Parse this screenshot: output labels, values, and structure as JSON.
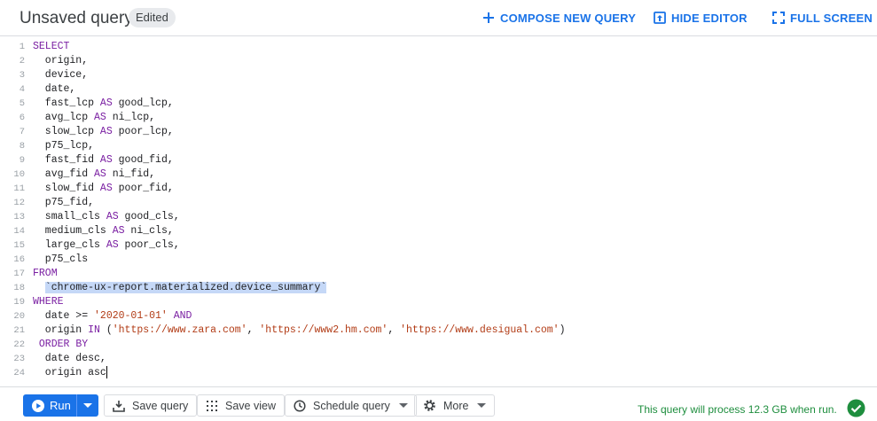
{
  "header": {
    "title": "Unsaved query",
    "badge": "Edited",
    "compose_label": "COMPOSE NEW QUERY",
    "hide_label": "HIDE EDITOR",
    "fullscreen_label": "FULL SCREEN"
  },
  "editor": {
    "lines": [
      {
        "n": "1",
        "segs": [
          {
            "t": "SELECT",
            "c": "kw"
          }
        ]
      },
      {
        "n": "2",
        "segs": [
          {
            "t": "  origin,",
            "c": ""
          }
        ]
      },
      {
        "n": "3",
        "segs": [
          {
            "t": "  device,",
            "c": ""
          }
        ]
      },
      {
        "n": "4",
        "segs": [
          {
            "t": "  date,",
            "c": ""
          }
        ]
      },
      {
        "n": "5",
        "segs": [
          {
            "t": "  fast_lcp ",
            "c": ""
          },
          {
            "t": "AS",
            "c": "kw"
          },
          {
            "t": " good_lcp,",
            "c": ""
          }
        ]
      },
      {
        "n": "6",
        "segs": [
          {
            "t": "  avg_lcp ",
            "c": ""
          },
          {
            "t": "AS",
            "c": "kw"
          },
          {
            "t": " ni_lcp,",
            "c": ""
          }
        ]
      },
      {
        "n": "7",
        "segs": [
          {
            "t": "  slow_lcp ",
            "c": ""
          },
          {
            "t": "AS",
            "c": "kw"
          },
          {
            "t": " poor_lcp,",
            "c": ""
          }
        ]
      },
      {
        "n": "8",
        "segs": [
          {
            "t": "  p75_lcp,",
            "c": ""
          }
        ]
      },
      {
        "n": "9",
        "segs": [
          {
            "t": "  fast_fid ",
            "c": ""
          },
          {
            "t": "AS",
            "c": "kw"
          },
          {
            "t": " good_fid,",
            "c": ""
          }
        ]
      },
      {
        "n": "10",
        "segs": [
          {
            "t": "  avg_fid ",
            "c": ""
          },
          {
            "t": "AS",
            "c": "kw"
          },
          {
            "t": " ni_fid,",
            "c": ""
          }
        ]
      },
      {
        "n": "11",
        "segs": [
          {
            "t": "  slow_fid ",
            "c": ""
          },
          {
            "t": "AS",
            "c": "kw"
          },
          {
            "t": " poor_fid,",
            "c": ""
          }
        ]
      },
      {
        "n": "12",
        "segs": [
          {
            "t": "  p75_fid,",
            "c": ""
          }
        ]
      },
      {
        "n": "13",
        "segs": [
          {
            "t": "  small_cls ",
            "c": ""
          },
          {
            "t": "AS",
            "c": "kw"
          },
          {
            "t": " good_cls,",
            "c": ""
          }
        ]
      },
      {
        "n": "14",
        "segs": [
          {
            "t": "  medium_cls ",
            "c": ""
          },
          {
            "t": "AS",
            "c": "kw"
          },
          {
            "t": " ni_cls,",
            "c": ""
          }
        ]
      },
      {
        "n": "15",
        "segs": [
          {
            "t": "  large_cls ",
            "c": ""
          },
          {
            "t": "AS",
            "c": "kw"
          },
          {
            "t": " poor_cls,",
            "c": ""
          }
        ]
      },
      {
        "n": "16",
        "segs": [
          {
            "t": "  p75_cls",
            "c": ""
          }
        ]
      },
      {
        "n": "17",
        "segs": [
          {
            "t": "FROM",
            "c": "kw"
          }
        ]
      },
      {
        "n": "18",
        "segs": [
          {
            "t": "  ",
            "c": ""
          },
          {
            "t": "`chrome-ux-report.materialized.device_summary`",
            "c": "hl"
          }
        ]
      },
      {
        "n": "19",
        "segs": [
          {
            "t": "WHERE",
            "c": "kw"
          }
        ]
      },
      {
        "n": "20",
        "segs": [
          {
            "t": "  date >= ",
            "c": ""
          },
          {
            "t": "'2020-01-01'",
            "c": "str"
          },
          {
            "t": " ",
            "c": ""
          },
          {
            "t": "AND",
            "c": "kw"
          }
        ]
      },
      {
        "n": "21",
        "segs": [
          {
            "t": "  origin ",
            "c": ""
          },
          {
            "t": "IN",
            "c": "kw"
          },
          {
            "t": " (",
            "c": ""
          },
          {
            "t": "'https://www.zara.com'",
            "c": "str"
          },
          {
            "t": ", ",
            "c": ""
          },
          {
            "t": "'https://www2.hm.com'",
            "c": "str"
          },
          {
            "t": ", ",
            "c": ""
          },
          {
            "t": "'https://www.desigual.com'",
            "c": "str"
          },
          {
            "t": ")",
            "c": ""
          }
        ]
      },
      {
        "n": "22",
        "segs": [
          {
            "t": " ",
            "c": ""
          },
          {
            "t": "ORDER BY",
            "c": "kw"
          }
        ]
      },
      {
        "n": "23",
        "segs": [
          {
            "t": "  date desc,",
            "c": ""
          }
        ]
      },
      {
        "n": "24",
        "segs": [
          {
            "t": "  origin asc",
            "c": ""
          },
          {
            "t": "",
            "c": "cursor"
          }
        ]
      }
    ]
  },
  "toolbar": {
    "run_label": "Run",
    "save_query_label": "Save query",
    "save_view_label": "Save view",
    "schedule_label": "Schedule query",
    "more_label": "More",
    "status_text": "This query will process 12.3 GB when run."
  },
  "colors": {
    "accent": "#1a73e8",
    "success": "#1e8e3e",
    "keyword": "#7a1fa2",
    "string": "#b23c16"
  }
}
